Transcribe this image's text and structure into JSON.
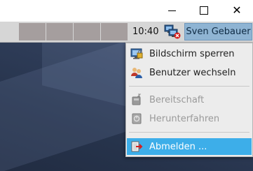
{
  "window": {
    "minimize_icon": "minimize-icon",
    "maximize_icon": "maximize-icon",
    "close_icon": "close-icon",
    "close_glyph": "✕"
  },
  "panel": {
    "clock": "10:40",
    "network_icon": "network-disconnected-icon",
    "user_name": "Sven Gebauer",
    "workspace_count": 4
  },
  "menu": {
    "items": [
      {
        "label": "Bildschirm sperren",
        "icon": "lock-screen-icon",
        "enabled": true
      },
      {
        "label": "Benutzer wechseln",
        "icon": "switch-user-icon",
        "enabled": true
      },
      {
        "label": "Bereitschaft",
        "icon": "suspend-icon",
        "enabled": false
      },
      {
        "label": "Herunterfahren",
        "icon": "shutdown-icon",
        "enabled": false
      },
      {
        "label": "Abmelden ...",
        "icon": "logout-icon",
        "enabled": true,
        "highlighted": true
      }
    ]
  },
  "colors": {
    "highlight": "#3daee9",
    "user_button": "#8fb4d3",
    "panel": "#d6d6d6",
    "workspace": "#a59e9e"
  }
}
